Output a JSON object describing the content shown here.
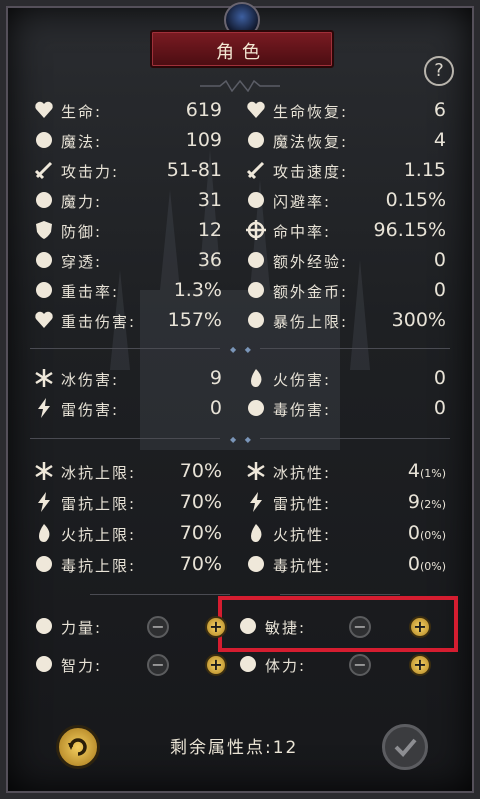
{
  "header": {
    "title": "角色"
  },
  "help_label": "?",
  "stats_top": [
    {
      "icon": "heart-icon",
      "label": "生命:",
      "value": "619"
    },
    {
      "icon": "heart-plus-icon",
      "label": "生命恢复:",
      "value": "6"
    },
    {
      "icon": "magic-swirl-icon",
      "label": "魔法:",
      "value": "109"
    },
    {
      "icon": "magic-plus-icon",
      "label": "魔法恢复:",
      "value": "4"
    },
    {
      "icon": "sword-icon",
      "label": "攻击力:",
      "value": "51-81"
    },
    {
      "icon": "speed-sword-icon",
      "label": "攻击速度:",
      "value": "1.15"
    },
    {
      "icon": "magic-power-icon",
      "label": "魔力:",
      "value": "31"
    },
    {
      "icon": "dodge-figure-icon",
      "label": "闪避率:",
      "value": "0.15%"
    },
    {
      "icon": "shield-icon",
      "label": "防御:",
      "value": "12"
    },
    {
      "icon": "crosshair-icon",
      "label": "命中率:",
      "value": "96.15%"
    },
    {
      "icon": "pierce-icon",
      "label": "穿透:",
      "value": "36"
    },
    {
      "icon": "exp-arrows-icon",
      "label": "额外经验:",
      "value": "0"
    },
    {
      "icon": "critical-icon",
      "label": "重击率:",
      "value": "1.3%"
    },
    {
      "icon": "coins-icon",
      "label": "额外金币:",
      "value": "0"
    },
    {
      "icon": "broken-heart-icon",
      "label": "重击伤害:",
      "value": "157%"
    },
    {
      "icon": "burst-icon",
      "label": "暴伤上限:",
      "value": "300%"
    }
  ],
  "stats_element": [
    {
      "icon": "ice-icon",
      "label": "冰伤害:",
      "value": "9"
    },
    {
      "icon": "fire-icon",
      "label": "火伤害:",
      "value": "0"
    },
    {
      "icon": "lightning-icon",
      "label": "雷伤害:",
      "value": "0"
    },
    {
      "icon": "poison-icon",
      "label": "毒伤害:",
      "value": "0"
    }
  ],
  "stats_resist": [
    {
      "icon": "ice-resist-cap-icon",
      "label": "冰抗上限:",
      "value": "70%",
      "sub": ""
    },
    {
      "icon": "ice-resist-icon",
      "label": "冰抗性:",
      "value": "4",
      "sub": "(1%)"
    },
    {
      "icon": "lightning-resist-cap-icon",
      "label": "雷抗上限:",
      "value": "70%",
      "sub": ""
    },
    {
      "icon": "lightning-resist-icon",
      "label": "雷抗性:",
      "value": "9",
      "sub": "(2%)"
    },
    {
      "icon": "fire-resist-cap-icon",
      "label": "火抗上限:",
      "value": "70%",
      "sub": ""
    },
    {
      "icon": "fire-resist-icon",
      "label": "火抗性:",
      "value": "0",
      "sub": "(0%)"
    },
    {
      "icon": "poison-resist-cap-icon",
      "label": "毒抗上限:",
      "value": "70%",
      "sub": ""
    },
    {
      "icon": "poison-resist-icon",
      "label": "毒抗性:",
      "value": "0",
      "sub": "(0%)"
    }
  ],
  "attributes": [
    {
      "icon": "strength-arm-icon",
      "label": "力量:"
    },
    {
      "icon": "agility-runner-icon",
      "label": "敏捷:"
    },
    {
      "icon": "brain-icon",
      "label": "智力:"
    },
    {
      "icon": "body-icon",
      "label": "体力:"
    }
  ],
  "remaining_points": "剩余属性点:12",
  "colors": {
    "accent_red": "#d51d30",
    "gold": "#f4cf60",
    "header_red": "#7a1b22"
  }
}
